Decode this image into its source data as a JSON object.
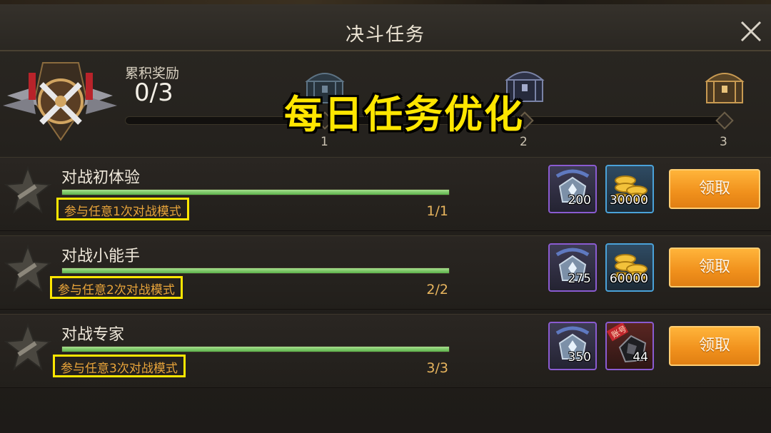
{
  "window": {
    "title": "决斗任务",
    "close_icon": "close-icon"
  },
  "rewards": {
    "label": "累积奖励",
    "count": "0/3",
    "milestones": [
      {
        "label": "1",
        "chest": "chest-icon"
      },
      {
        "label": "2",
        "chest": "chest-icon"
      },
      {
        "label": "3",
        "chest": "chest-icon"
      }
    ]
  },
  "overlay_banner": "每日任务优化",
  "tasks": [
    {
      "name": "对战初体验",
      "description": "参与任意1次对战模式",
      "progress": "1/1",
      "completion": 1.0,
      "rewards": [
        {
          "icon": "crystal-icon",
          "qty": "200",
          "rarity": "purple"
        },
        {
          "icon": "gold-coins-icon",
          "qty": "30000",
          "rarity": "blue"
        }
      ],
      "button": "领取"
    },
    {
      "name": "对战小能手",
      "description": "参与任意2次对战模式",
      "progress": "2/2",
      "completion": 1.0,
      "rewards": [
        {
          "icon": "crystal-icon",
          "qty": "275",
          "rarity": "purple"
        },
        {
          "icon": "gold-coins-icon",
          "qty": "60000",
          "rarity": "blue"
        }
      ],
      "button": "领取"
    },
    {
      "name": "对战专家",
      "description": "参与任意3次对战模式",
      "progress": "3/3",
      "completion": 1.0,
      "rewards": [
        {
          "icon": "crystal-icon",
          "qty": "350",
          "rarity": "purple"
        },
        {
          "icon": "account-item-icon",
          "qty": "44",
          "rarity": "purple",
          "tag": "账号"
        }
      ],
      "button": "领取"
    }
  ],
  "colors": {
    "highlight_box": "#ffe600",
    "progress_fill": "#5bb24a",
    "claim_button": "#f0901c",
    "desc_text": "#e8a43a"
  }
}
